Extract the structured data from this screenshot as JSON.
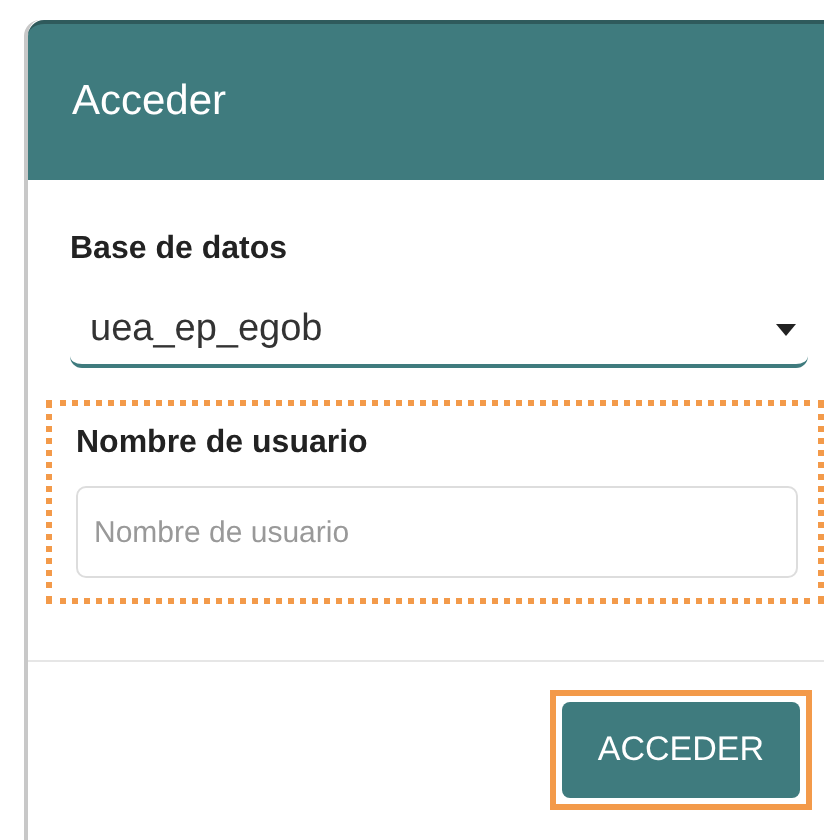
{
  "dialog": {
    "title": "Acceder"
  },
  "database": {
    "label": "Base de datos",
    "value": "uea_ep_egob"
  },
  "username": {
    "label": "Nombre de usuario",
    "placeholder": "Nombre de usuario",
    "highlighted": true
  },
  "login_button": {
    "label": "ACCEDER",
    "highlighted": true
  }
}
